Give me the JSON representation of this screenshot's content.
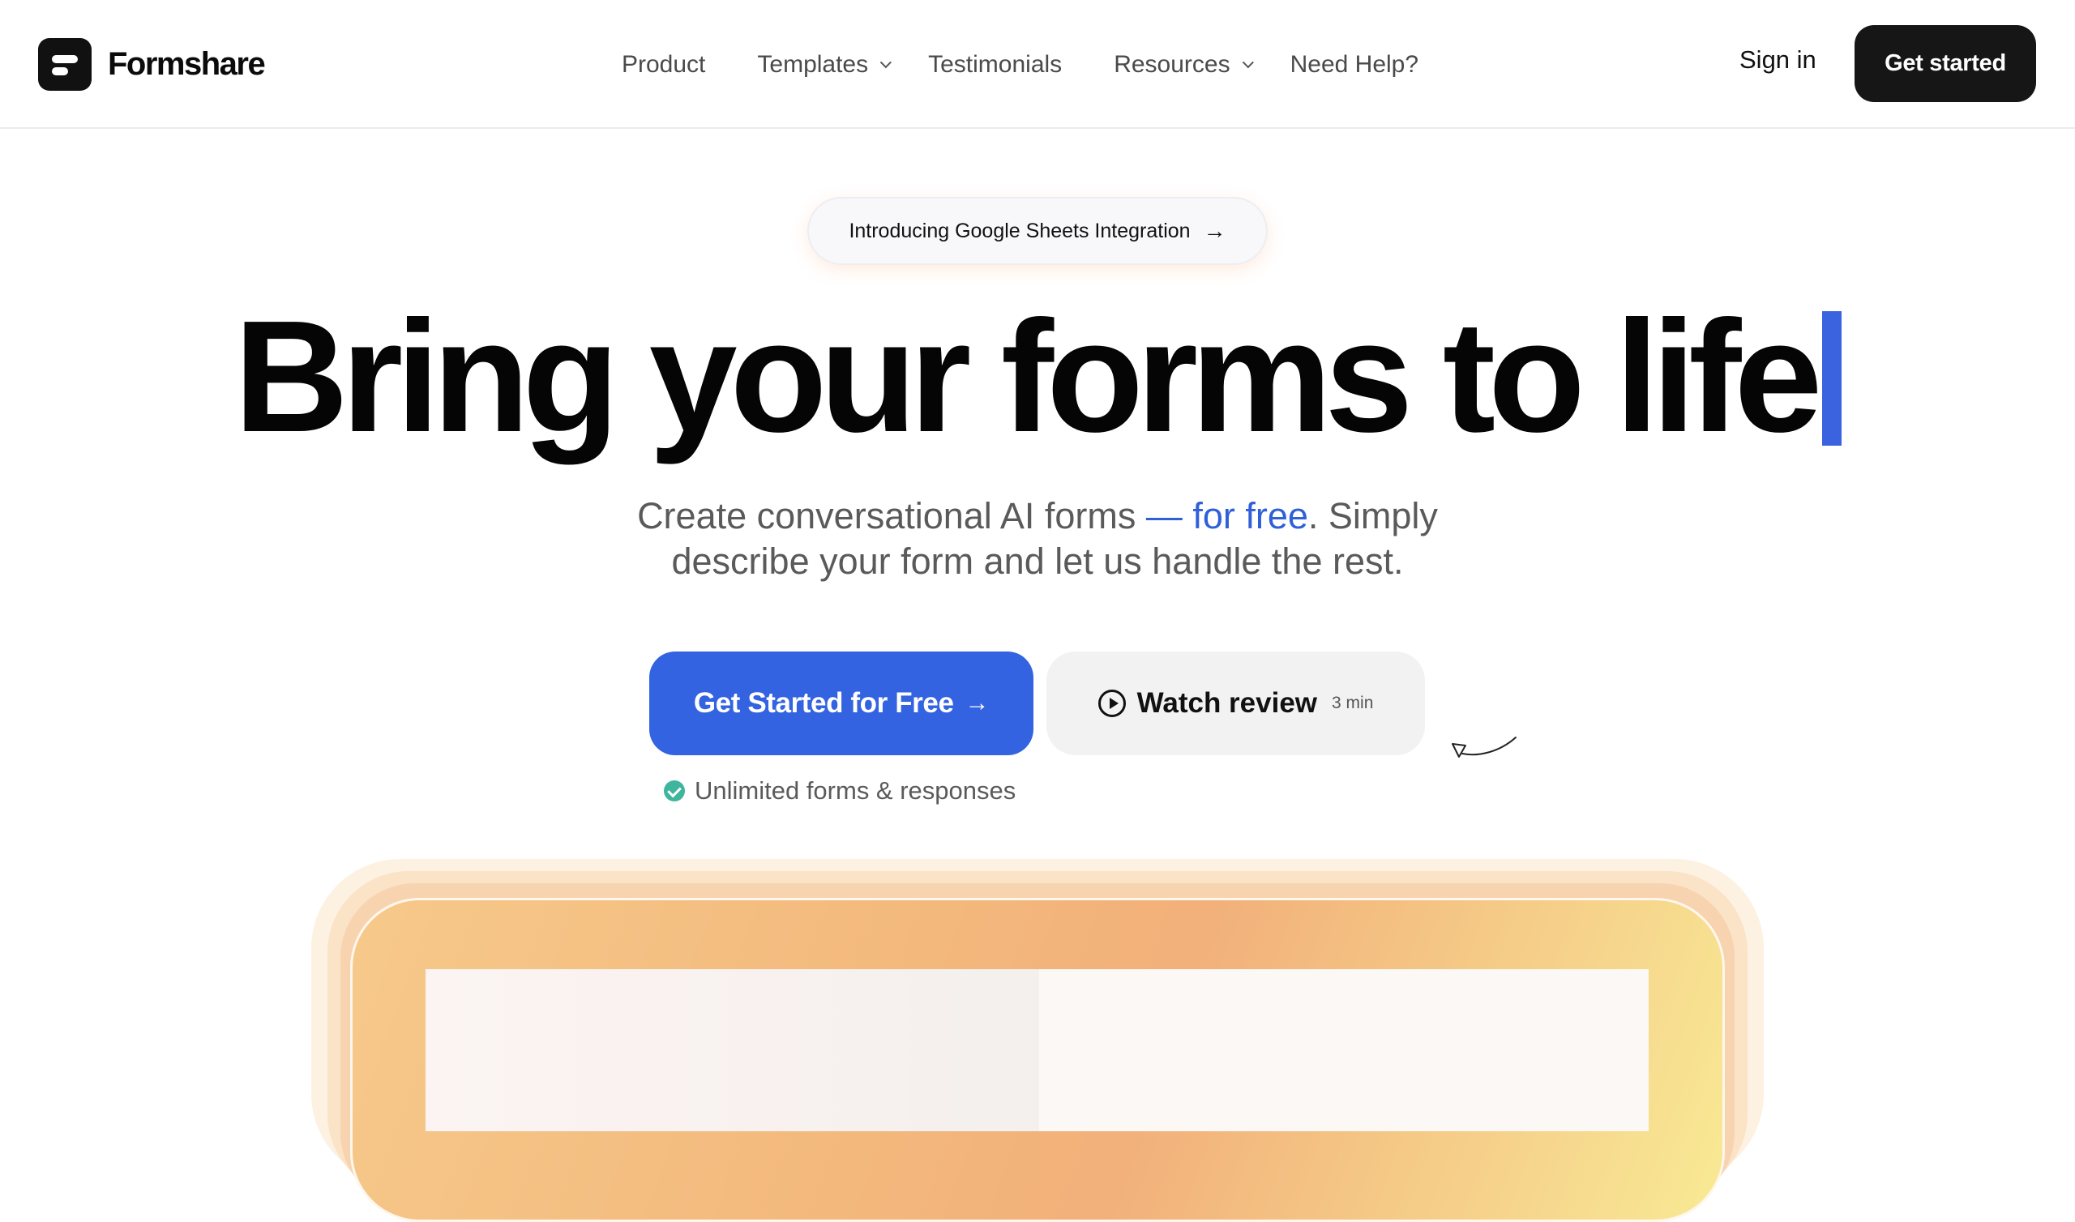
{
  "brand": {
    "name": "Formshare"
  },
  "nav": {
    "items": [
      {
        "label": "Product",
        "has_dropdown": false
      },
      {
        "label": "Templates",
        "has_dropdown": true
      },
      {
        "label": "Testimonials",
        "has_dropdown": false
      },
      {
        "label": "Resources",
        "has_dropdown": true
      },
      {
        "label": "Need Help?",
        "has_dropdown": false
      }
    ],
    "sign_in": "Sign in",
    "get_started": "Get started"
  },
  "hero": {
    "announcement": "Introducing Google Sheets Integration",
    "announcement_icon": "arrow-right-icon",
    "headline": "Bring your forms to life",
    "subtext_part1": "Create conversational AI forms ",
    "subtext_highlight": "— for free",
    "subtext_part2": ". Simply",
    "subtext_line2": "describe your form and let us handle the rest.",
    "primary_cta": "Get Started for Free",
    "primary_cta_icon": "arrow-right-icon",
    "secondary_cta": "Watch review",
    "secondary_cta_icon": "play-circle-icon",
    "secondary_cta_duration": "3 min",
    "feature_note": "Unlimited forms & responses",
    "feature_note_icon": "check-badge-icon"
  },
  "colors": {
    "accent": "#3463e1",
    "caret": "#3b63e0",
    "dark_button": "#161616",
    "check": "#3fb59e"
  }
}
